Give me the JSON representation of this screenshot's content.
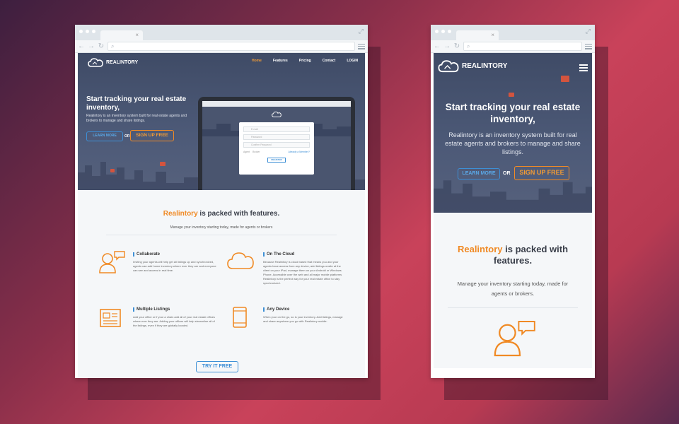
{
  "desktop": {
    "tab_close": "×",
    "nav": {
      "back": "←",
      "forward": "→",
      "reload": "↻",
      "search_glyph": "⌕"
    },
    "logo_text": "REALINTORY",
    "menu": [
      "Home",
      "Features",
      "Pricing",
      "Contact",
      "LOGIN"
    ],
    "hero": {
      "title": "Start tracking your real estate inventory,",
      "description": "Realintory is an inventory system built for real estate agents and brokers to manage and share listings.",
      "learn_more": "LEARN MORE",
      "or": "OR",
      "sign_up": "SIGN UP FREE"
    },
    "laptop_modal": {
      "fields": [
        "E-mail",
        "Password",
        "Confirm Password"
      ],
      "options": [
        "Agent",
        "Broker"
      ],
      "options_link": "Already a Member?",
      "button": "REGISTER"
    },
    "features": {
      "title_brand": "Realintory",
      "title_rest": " is packed with features.",
      "subtitle": "Manage your inventory starting today, made for agents or brokers",
      "items": [
        {
          "title": "Collaborate",
          "icon": "person-chat-icon",
          "text": "Inviting your agents will help get all listings up and synchronized, agents can add home inventory where ever they are and everyone can see and access in real time."
        },
        {
          "title": "On The Cloud",
          "icon": "cloud-icon",
          "text": "Because Realintory is cloud based that means you and your agents have access from any device, add listings onsite at the client on your iPad, manage them on your Android or Windows Phone. Accessible over the web and all major mobile platforms Realintory is the perfect way for your real estate office to stay synchronized."
        },
        {
          "title": "Multiple Listings",
          "icon": "newspaper-icon",
          "text": "Add your office or if your a chain add all of your real estate offices where ever they are. Adding your offices will help streamline all of the listings, even if they are globally located."
        },
        {
          "title": "Any Device",
          "icon": "mobile-device-icon",
          "text": "When your on the go, so is your inventory. Add listings, manage and share anywhere you go with Realintory mobile."
        }
      ],
      "try_button": "TRY IT FREE"
    }
  },
  "mobile": {
    "tab_close": "×",
    "nav": {
      "back": "←",
      "forward": "→",
      "reload": "↻",
      "search_glyph": "⌕"
    },
    "logo_text": "REALINTORY",
    "hero": {
      "title": "Start tracking your real estate inventory,",
      "description": "Realintory is an inventory system built for real estate agents and brokers to manage and share listings.",
      "learn_more": "LEARN MORE",
      "or": "OR",
      "sign_up": "SIGN UP FREE"
    },
    "features": {
      "title_brand": "Realintory",
      "title_rest": " is packed with features.",
      "subtitle": "Manage your inventory starting today, made for agents or brokers."
    }
  },
  "colors": {
    "accent_orange": "#f08a25",
    "accent_blue": "#3d8fd6",
    "hero_bg": "#4d5a78",
    "background": "#c9425a"
  }
}
